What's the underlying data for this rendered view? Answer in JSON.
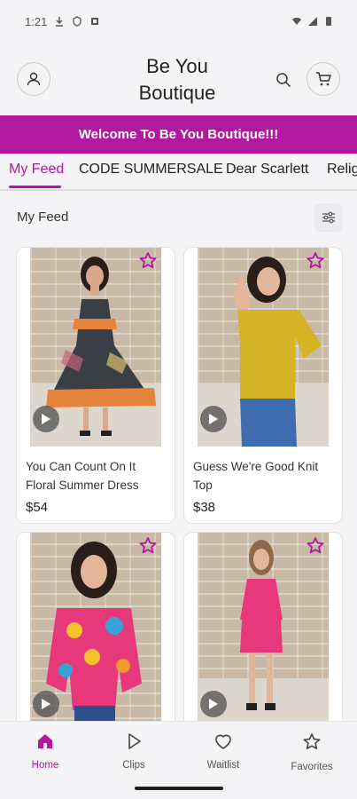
{
  "status_bar": {
    "time": "1:21"
  },
  "header": {
    "title_line1": "Be You",
    "title_line2": "Boutique"
  },
  "banner": {
    "text": "Welcome To Be You Boutique!!!"
  },
  "tabs": [
    {
      "label": "My Feed"
    },
    {
      "label": "CODE SUMMERSALE"
    },
    {
      "label": "Dear Scarlett"
    },
    {
      "label": "Relig"
    }
  ],
  "feed": {
    "title": "My Feed"
  },
  "products": [
    {
      "name": "You Can Count On It Floral Summer Dress",
      "price": "$54"
    },
    {
      "name": "Guess We're Good Knit Top",
      "price": "$38"
    },
    {
      "name": "",
      "price": ""
    },
    {
      "name": "",
      "price": ""
    }
  ],
  "bottom_nav": [
    {
      "label": "Home",
      "icon": "home-icon"
    },
    {
      "label": "Clips",
      "icon": "play-icon"
    },
    {
      "label": "Waitlist",
      "icon": "heart-icon"
    },
    {
      "label": "Favorites",
      "icon": "star-icon"
    }
  ],
  "colors": {
    "accent": "#b3199f"
  }
}
